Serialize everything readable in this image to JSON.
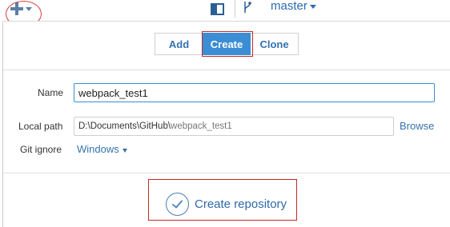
{
  "toolbar": {
    "add_menu_icon": "plus-icon",
    "add_menu_caret": "caret-down-icon",
    "panel_toggle_icon": "panel-toggle-icon",
    "branch_icon": "branch-icon",
    "branch_name": "master"
  },
  "tabs": [
    {
      "label": "Add",
      "active": false
    },
    {
      "label": "Create",
      "active": true
    },
    {
      "label": "Clone",
      "active": false
    }
  ],
  "form": {
    "name_label": "Name",
    "name_value": "webpack_test1",
    "local_path_label": "Local path",
    "local_path_prefix": "D:\\Documents\\GitHub\\",
    "local_path_suffix": "webpack_test1",
    "browse_label": "Browse",
    "git_ignore_label": "Git ignore",
    "git_ignore_value": "Windows"
  },
  "actions": {
    "create_repository_label": "Create repository",
    "create_repository_icon": "check-circle-icon"
  },
  "colors": {
    "accent": "#3b8dd4",
    "link": "#3572b0",
    "annotation": "#c62828"
  }
}
